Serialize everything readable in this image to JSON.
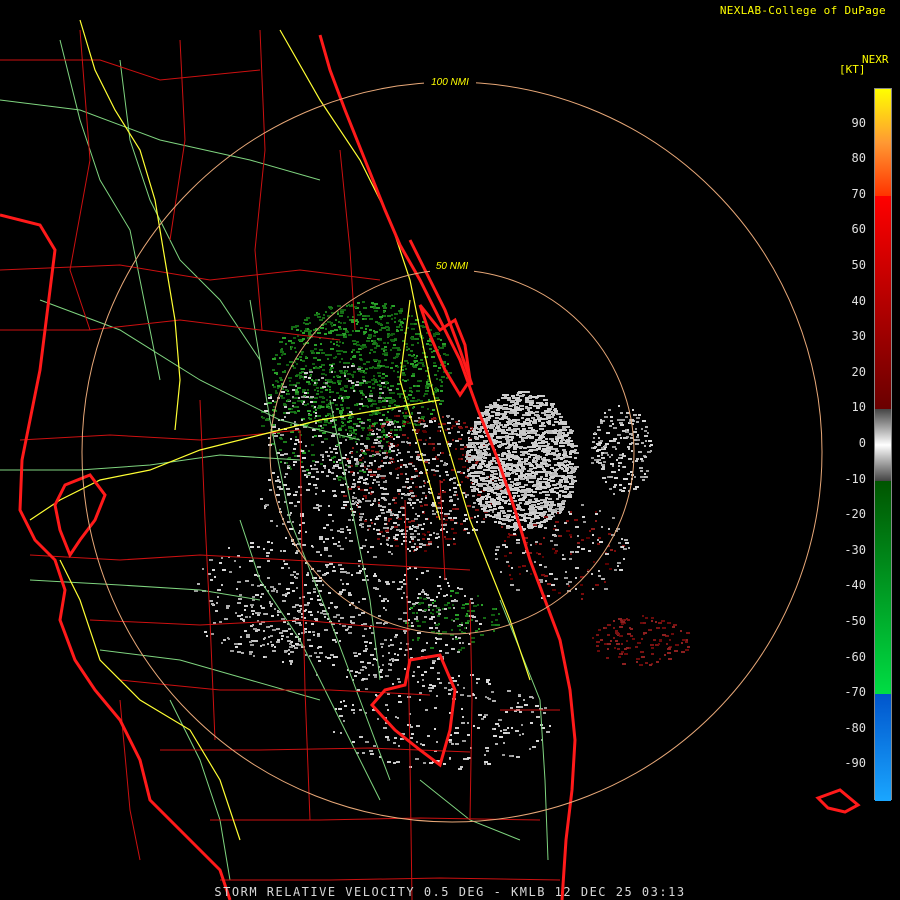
{
  "credit": "NEXLAB-College of DuPage",
  "footer": "STORM RELATIVE VELOCITY 0.5 DEG - KMLB 12 DEC 25 03:13",
  "range_rings": [
    "100 NMI",
    "50 NMI"
  ],
  "legend": {
    "title": "NEXR",
    "unit": "[KT]",
    "ticks": [
      "90",
      "80",
      "70",
      "60",
      "50",
      "40",
      "30",
      "20",
      "10",
      "0",
      "-10",
      "-20",
      "-30",
      "-40",
      "-50",
      "-60",
      "-70",
      "-80",
      "-90"
    ],
    "bands": [
      {
        "from": 100,
        "to": 70,
        "colors": [
          "#ffff00",
          "#ff9933",
          "#ff3300"
        ]
      },
      {
        "from": 70,
        "to": 10,
        "colors": [
          "#ff0000",
          "#6a0000"
        ]
      },
      {
        "from": 10,
        "to": -10,
        "colors": [
          "#444444",
          "#ffffff",
          "#444444"
        ]
      },
      {
        "from": -10,
        "to": -70,
        "colors": [
          "#005500",
          "#00dd44"
        ]
      },
      {
        "from": -70,
        "to": -100,
        "colors": [
          "#0055cc",
          "#1aa6ff"
        ]
      }
    ]
  },
  "colors": {
    "county_lines": "#cc1010",
    "coastline": "#ff1a1a",
    "highways": "#ffff33",
    "roads": "#7fd47f",
    "range_ring": "#e8a878"
  }
}
